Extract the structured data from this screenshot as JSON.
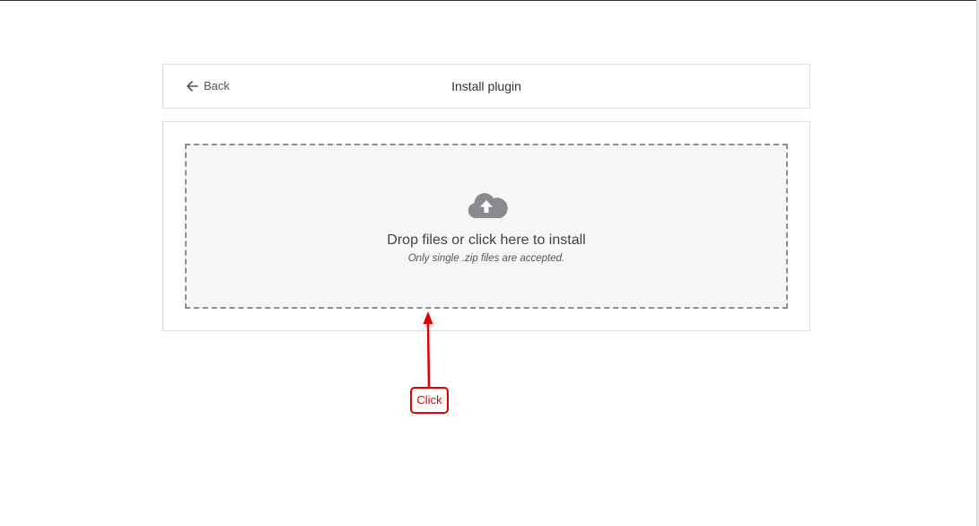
{
  "header": {
    "back_label": "Back",
    "title": "Install plugin"
  },
  "dropzone": {
    "icon": "cloud-upload-icon",
    "text": "Drop files or click here to install",
    "hint": "Only single .zip files are accepted."
  },
  "annotation": {
    "label": "Click",
    "color": "#e00000"
  },
  "colors": {
    "dropzone_background": "#f5f6f6",
    "dropzone_border": "#8f8f8f",
    "icon": "#8a8a8e",
    "card_border": "#dcdcdc"
  }
}
